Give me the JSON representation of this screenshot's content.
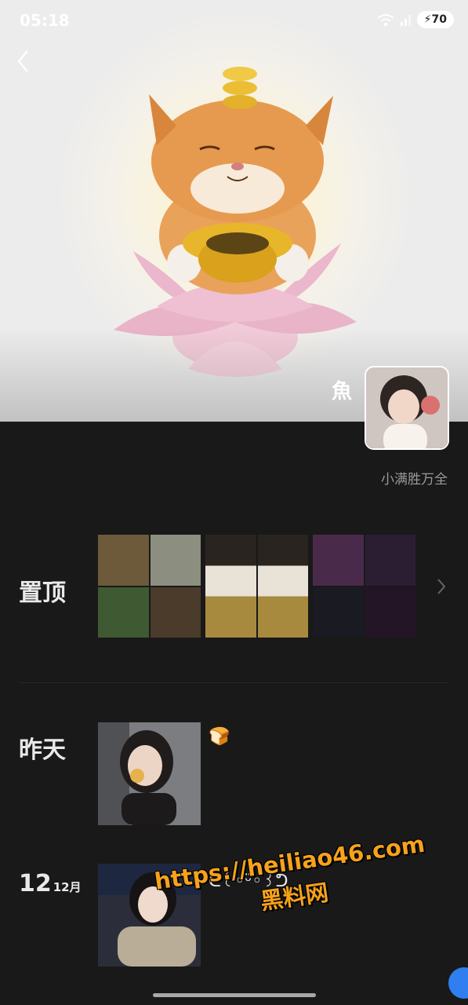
{
  "status_bar": {
    "time": "05:18",
    "battery": "70"
  },
  "profile": {
    "nickname": "魚",
    "signature": "小满胜万全"
  },
  "sections": {
    "pinned": {
      "label": "置顶"
    },
    "yesterday": {
      "label": "昨天",
      "post_text": "🍞"
    },
    "dec12": {
      "day": "12",
      "month": "12月",
      "post_text": "ᕦ꒰◦ᵕ̈◦꒱ᕤ"
    }
  },
  "watermark": {
    "line1": "https://heiliao46.com",
    "line2": "黑料网"
  },
  "colors": {
    "background": "#191919",
    "accent_watermark": "#f7a21b",
    "float_button": "#2f7ff0"
  }
}
